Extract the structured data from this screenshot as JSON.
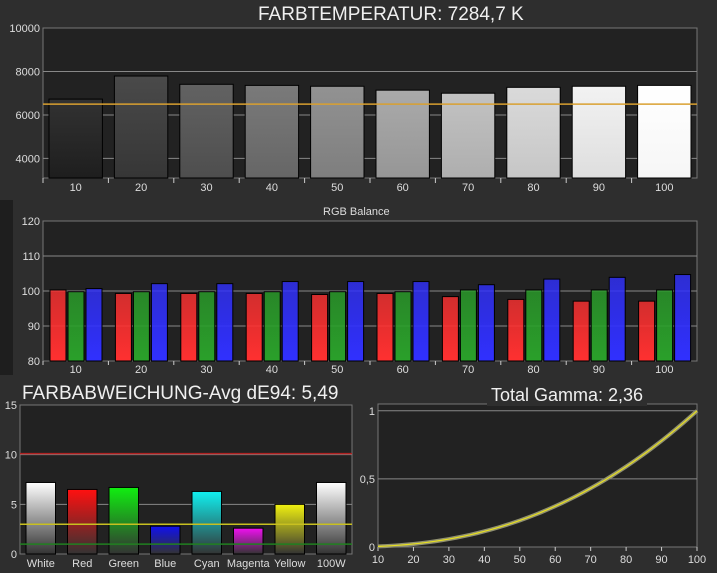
{
  "chart_data": [
    {
      "id": "cct",
      "type": "bar",
      "title": "FARBTEMPERATUR: 7284,7 K",
      "categories": [
        "10",
        "20",
        "30",
        "40",
        "50",
        "60",
        "70",
        "80",
        "90",
        "100"
      ],
      "values": [
        6730,
        7790,
        7410,
        7360,
        7320,
        7140,
        7000,
        7270,
        7320,
        7360
      ],
      "reference_line": {
        "value": 6500,
        "color": "#d9a030"
      },
      "yticks": [
        4000,
        6000,
        8000,
        10000
      ],
      "ylim": [
        3100,
        10000
      ],
      "grid": true
    },
    {
      "id": "rgb",
      "type": "bar",
      "title": "RGB Balance",
      "categories": [
        "10",
        "20",
        "30",
        "40",
        "50",
        "60",
        "70",
        "80",
        "90",
        "100"
      ],
      "series": [
        {
          "name": "Red",
          "color": "#ff3030",
          "values": [
            100.3,
            99.3,
            99.3,
            99.3,
            99.0,
            99.3,
            98.4,
            97.6,
            97.1,
            97.1
          ]
        },
        {
          "name": "Green",
          "color": "#2aa02a",
          "values": [
            99.8,
            99.8,
            99.8,
            99.8,
            99.8,
            99.8,
            100.3,
            100.3,
            100.3,
            100.3
          ]
        },
        {
          "name": "Blue",
          "color": "#3030ff",
          "values": [
            100.7,
            102.1,
            102.1,
            102.7,
            102.7,
            102.7,
            101.8,
            103.4,
            103.9,
            104.7
          ]
        }
      ],
      "yticks": [
        80,
        90,
        100,
        110,
        120
      ],
      "ylim": [
        80,
        120
      ],
      "grid": true
    },
    {
      "id": "de",
      "type": "bar",
      "title": "FARBABWEICHUNG-Avg dE94: 5,49",
      "categories": [
        "White",
        "Red",
        "Green",
        "Blue",
        "Cyan",
        "Magenta",
        "Yellow",
        "100W"
      ],
      "values": [
        7.2,
        6.5,
        6.7,
        2.8,
        6.3,
        2.6,
        5.0,
        7.2
      ],
      "colors": [
        "#ffffff",
        "#ff1010",
        "#10ee10",
        "#1010ee",
        "#10f0f0",
        "#f010f0",
        "#f0f010",
        "#ffffff"
      ],
      "reference_lines": [
        {
          "value": 10.1,
          "color": "#b02020"
        },
        {
          "value": 3,
          "color": "#c8c020"
        },
        {
          "value": 1,
          "color": "#208020"
        }
      ],
      "yticks": [
        0,
        5,
        10,
        15
      ],
      "ylim": [
        0,
        15
      ],
      "grid": true
    },
    {
      "id": "gamma",
      "type": "line",
      "title": "Total Gamma: 2,36",
      "gamma": 2.36,
      "xticks": [
        10,
        20,
        30,
        40,
        50,
        60,
        70,
        80,
        90,
        100
      ],
      "xlim": [
        10,
        100
      ],
      "yticks": [
        "0",
        "0,5",
        "1"
      ],
      "ylim": [
        0,
        1.05
      ],
      "grid": true,
      "series": [
        {
          "name": "measured",
          "color": "#e8e020"
        },
        {
          "name": "reference",
          "color": "#909070"
        }
      ]
    }
  ]
}
